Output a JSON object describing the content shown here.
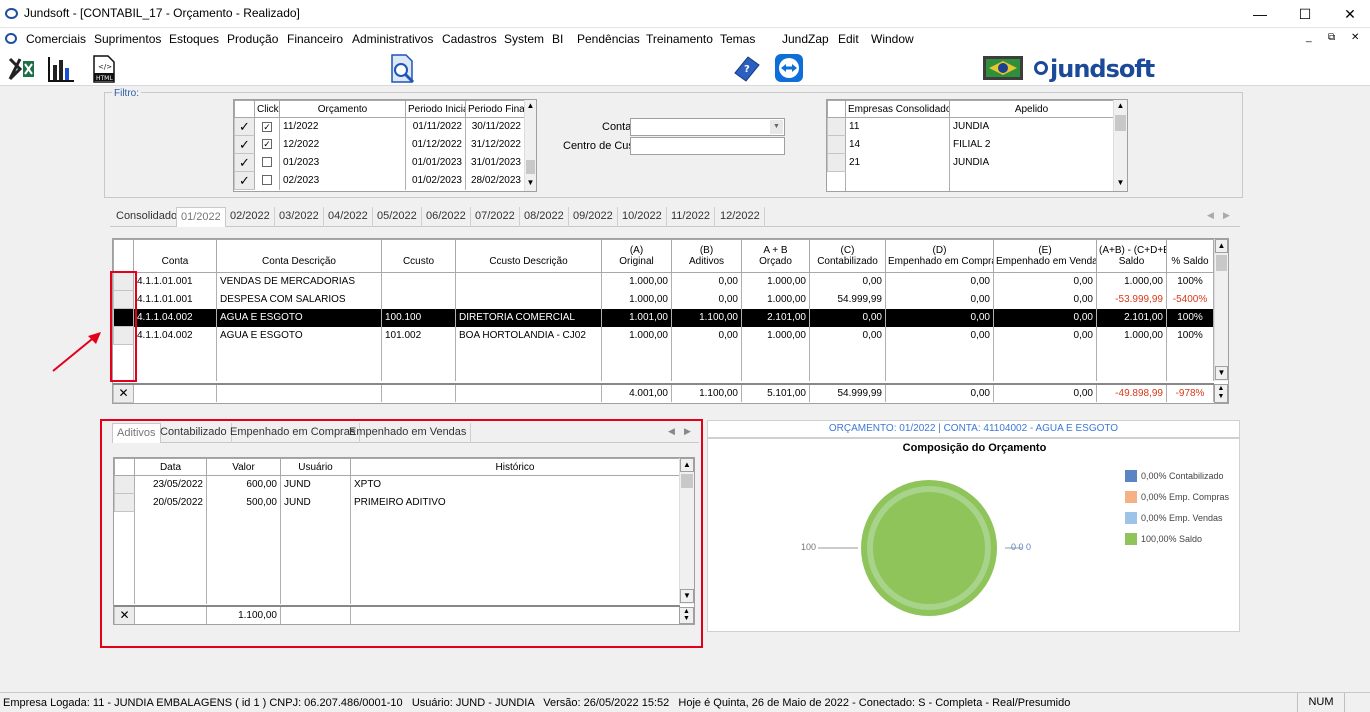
{
  "window": {
    "title": "Jundsoft - [CONTABIL_17 - Orçamento - Realizado]"
  },
  "menu": [
    "Comerciais",
    "Suprimentos",
    "Estoques",
    "Produção",
    "Financeiro",
    "Administrativos",
    "Cadastros",
    "System",
    "BI",
    "Pendências",
    "Treinamento",
    "Temas",
    "JundZap",
    "Edit",
    "Window"
  ],
  "toolbar": {
    "icons": [
      "excel-icon",
      "bar-chart-icon",
      "html-export-icon",
      "search-document-icon",
      "help-book-icon",
      "teamviewer-icon",
      "flag-icon"
    ],
    "logo": "jundsoft"
  },
  "filter": {
    "label": "Filtro:",
    "periods_headers": [
      "Click",
      "Orçamento",
      "Periodo Inicial",
      "Periodo Final"
    ],
    "periods": [
      {
        "orc": "11/2022",
        "ini": "01/11/2022",
        "fim": "30/11/2022",
        "click": true
      },
      {
        "orc": "12/2022",
        "ini": "01/12/2022",
        "fim": "31/12/2022",
        "click": true
      },
      {
        "orc": "01/2023",
        "ini": "01/01/2023",
        "fim": "31/01/2023",
        "click": false
      },
      {
        "orc": "02/2023",
        "ini": "01/02/2023",
        "fim": "28/02/2023",
        "click": false
      }
    ],
    "conta_label": "Conta:",
    "centro_label": "Centro de Custo:",
    "empresas_headers": [
      "Empresas Consolidadoras",
      "Apelido"
    ],
    "empresas": [
      {
        "cod": "11",
        "apelido": "JUNDIA"
      },
      {
        "cod": "14",
        "apelido": "FILIAL 2"
      },
      {
        "cod": "21",
        "apelido": "JUNDIA"
      }
    ]
  },
  "month_tabs": [
    "Consolidado",
    "01/2022",
    "02/2022",
    "03/2022",
    "04/2022",
    "05/2022",
    "06/2022",
    "07/2022",
    "08/2022",
    "09/2022",
    "10/2022",
    "11/2022",
    "12/2022"
  ],
  "main_grid": {
    "headers": [
      {
        "l1": "",
        "l2": "Conta"
      },
      {
        "l1": "",
        "l2": "Conta Descrição"
      },
      {
        "l1": "",
        "l2": "Ccusto"
      },
      {
        "l1": "",
        "l2": "Ccusto Descrição"
      },
      {
        "l1": "(A)",
        "l2": "Original"
      },
      {
        "l1": "(B)",
        "l2": "Aditivos"
      },
      {
        "l1": "A + B",
        "l2": "Orçado"
      },
      {
        "l1": "(C)",
        "l2": "Contabilizado"
      },
      {
        "l1": "(D)",
        "l2": "Empenhado em Compras"
      },
      {
        "l1": "(E)",
        "l2": "Empenhado em Vendas"
      },
      {
        "l1": "(A+B) - (C+D+E)",
        "l2": "Saldo"
      },
      {
        "l1": "",
        "l2": "% Saldo"
      }
    ],
    "rows": [
      [
        "4.1.1.01.001",
        "VENDAS DE MERCADORIAS",
        "",
        "",
        "1.000,00",
        "0,00",
        "1.000,00",
        "0,00",
        "0,00",
        "0,00",
        "1.000,00",
        "100%"
      ],
      [
        "4.1.1.01.001",
        "DESPESA COM SALARIOS",
        "",
        "",
        "1.000,00",
        "0,00",
        "1.000,00",
        "54.999,99",
        "0,00",
        "0,00",
        "-53.999,99",
        "-5400%"
      ],
      [
        "4.1.1.04.002",
        "AGUA E ESGOTO",
        "100.100",
        "DIRETORIA COMERCIAL",
        "1.001,00",
        "1.100,00",
        "2.101,00",
        "0,00",
        "0,00",
        "0,00",
        "2.101,00",
        "100%"
      ],
      [
        "4.1.1.04.002",
        "AGUA E ESGOTO",
        "101.002",
        "BOA HORTOLANDIA - CJ02",
        "1.000,00",
        "0,00",
        "1.000,00",
        "0,00",
        "0,00",
        "0,00",
        "1.000,00",
        "100%"
      ]
    ],
    "totals": [
      "",
      "",
      "",
      "",
      "4.001,00",
      "1.100,00",
      "5.101,00",
      "54.999,99",
      "0,00",
      "0,00",
      "-49.898,99",
      "-978%"
    ]
  },
  "detail_tabs": [
    "Aditivos",
    "Contabilizado",
    "Empenhado em Compras",
    "Empenhado em Vendas"
  ],
  "detail_grid": {
    "headers": [
      "Data",
      "Valor",
      "Usuário",
      "Histórico"
    ],
    "rows": [
      [
        "23/05/2022",
        "600,00",
        "JUND",
        "XPTO"
      ],
      [
        "20/05/2022",
        "500,00",
        "JUND",
        "PRIMEIRO ADITIVO"
      ]
    ],
    "total": "1.100,00"
  },
  "chart_panel": {
    "header": "ORÇAMENTO: 01/2022 | CONTA: 41104002 - AGUA E ESGOTO",
    "label_left": "100",
    "label_right": "0 0 0"
  },
  "chart_data": {
    "type": "pie",
    "title": "Composição do Orçamento",
    "categories": [
      "0,00% Contabilizado",
      "0,00% Emp. Compras",
      "0,00% Emp. Vendas",
      "100,00% Saldo"
    ],
    "values": [
      0,
      0,
      0,
      100
    ],
    "colors": [
      "#5b84c4",
      "#f4b183",
      "#9dc3e6",
      "#8fc45a"
    ],
    "legend": "right"
  },
  "statusbar": {
    "text": "Empresa Logada: 11 - JUNDIA EMBALAGENS ( id 1 ) CNPJ: 06.207.486/0001-10   Usuário: JUND - JUNDIA   Versão: 26/05/2022 15:52   Hoje é Quinta, 26 de Maio de 2022 - Conectado: S - Completa - Real/Presumido",
    "num": "NUM"
  }
}
